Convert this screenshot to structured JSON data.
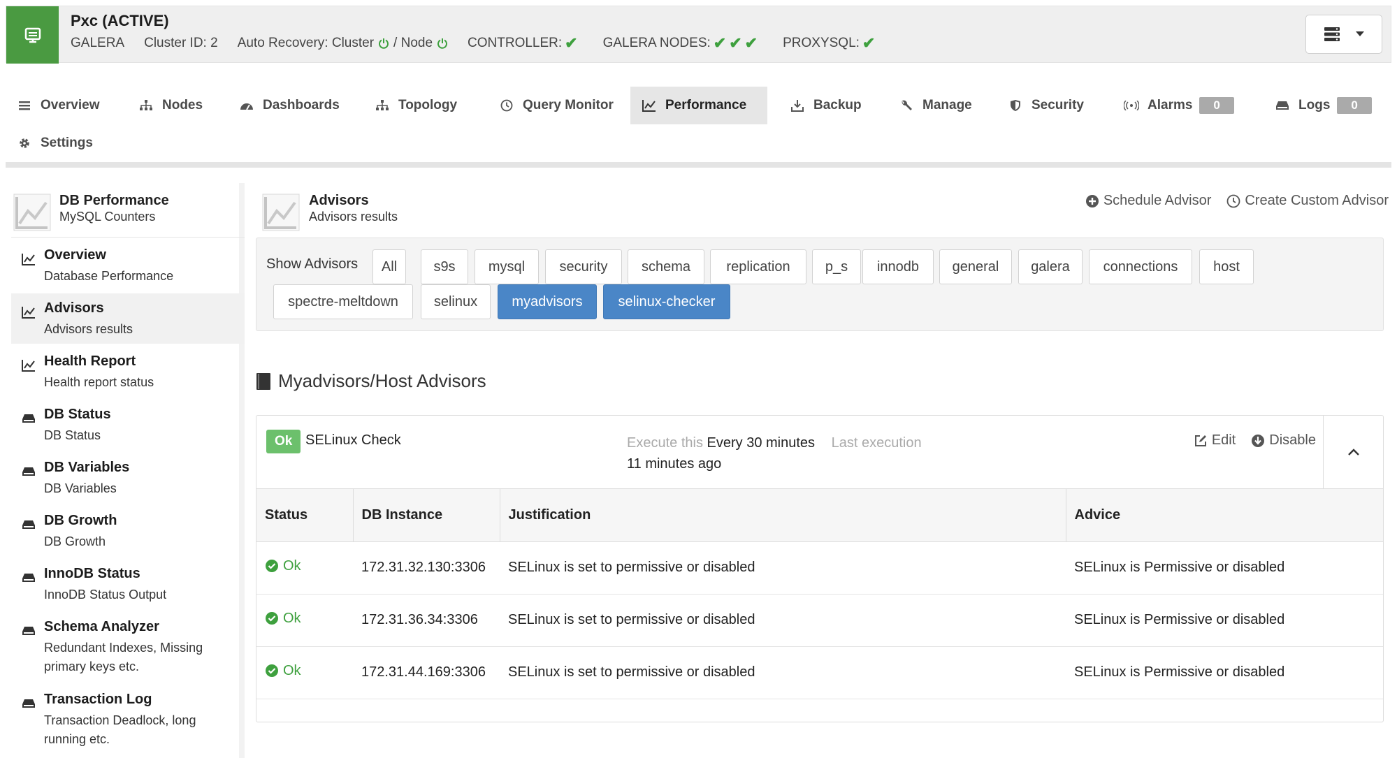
{
  "cluster": {
    "title": "Pxc (ACTIVE)",
    "type": "GALERA",
    "cluster_id": "Cluster ID: 2",
    "auto_recovery": "Auto Recovery: Cluster",
    "node_label": "/ Node",
    "controller": "CONTROLLER:",
    "galera_nodes": "GALERA NODES:",
    "proxysql": "PROXYSQL:",
    "accent": "#4a9a41",
    "ok_color": "#3ea03e"
  },
  "nav": {
    "items": [
      {
        "label": "Overview",
        "icon": "list-icon"
      },
      {
        "label": "Nodes",
        "icon": "sitemap-icon"
      },
      {
        "label": "Dashboards",
        "icon": "dashboard-icon"
      },
      {
        "label": "Topology",
        "icon": "topology-icon"
      },
      {
        "label": "Query Monitor",
        "icon": "clock-icon"
      },
      {
        "label": "Performance",
        "icon": "line-chart-icon"
      },
      {
        "label": "Backup",
        "icon": "download-icon"
      },
      {
        "label": "Manage",
        "icon": "wrench-icon"
      },
      {
        "label": "Security",
        "icon": "shield-icon"
      },
      {
        "label": "Alarms",
        "icon": "broadcast-icon",
        "badge": "0"
      },
      {
        "label": "Logs",
        "icon": "database-icon",
        "badge": "0"
      },
      {
        "label": "Settings",
        "icon": "gear-icon"
      }
    ],
    "active": "Performance"
  },
  "sidebar": {
    "title": "DB Performance",
    "subtitle": "MySQL Counters",
    "items": [
      {
        "title": "Overview",
        "sub": "Database Performance",
        "icon": "line-chart-icon"
      },
      {
        "title": "Advisors",
        "sub": "Advisors results",
        "icon": "line-chart-icon"
      },
      {
        "title": "Health Report",
        "sub": "Health report status",
        "icon": "line-chart-icon"
      },
      {
        "title": "DB Status",
        "sub": "DB Status",
        "icon": "drive-icon"
      },
      {
        "title": "DB Variables",
        "sub": "DB Variables",
        "icon": "drive-icon"
      },
      {
        "title": "DB Growth",
        "sub": "DB Growth",
        "icon": "drive-icon"
      },
      {
        "title": "InnoDB Status",
        "sub": "InnoDB Status Output",
        "icon": "drive-icon"
      },
      {
        "title": "Schema Analyzer",
        "sub": "Redundant Indexes, Missing primary keys etc.",
        "icon": "drive-icon"
      },
      {
        "title": "Transaction Log",
        "sub": "Transaction Deadlock, long running etc.",
        "icon": "drive-icon"
      }
    ]
  },
  "content": {
    "title": "Advisors",
    "subtitle": "Advisors results",
    "schedule_label": "Schedule Advisor",
    "create_label": "Create Custom Advisor"
  },
  "filters": {
    "label": "Show Advisors",
    "buttons": [
      "All",
      "s9s",
      "mysql",
      "security",
      "schema",
      "replication",
      "p_s",
      "innodb",
      "general",
      "galera",
      "connections",
      "host",
      "spectre-meltdown",
      "selinux",
      "myadvisors",
      "selinux-checker"
    ],
    "selected": [
      "myadvisors",
      "selinux-checker"
    ],
    "selected_color": "#4a86c7"
  },
  "section": {
    "title": "Myadvisors/Host Advisors"
  },
  "advisor": {
    "status_badge": "Ok",
    "name": "SELinux Check",
    "execute_label": "Execute this",
    "execute_value": "Every 30 minutes",
    "last_label": "Last execution",
    "last_value": "11 minutes ago",
    "edit_label": "Edit",
    "disable_label": "Disable",
    "columns": [
      "Status",
      "DB Instance",
      "Justification",
      "Advice"
    ],
    "rows": [
      {
        "status": "Ok",
        "instance": "172.31.32.130:3306",
        "justification": "SELinux is set to permissive or disabled",
        "advice": "SELinux is Permissive or disabled"
      },
      {
        "status": "Ok",
        "instance": "172.31.36.34:3306",
        "justification": "SELinux is set to permissive or disabled",
        "advice": "SELinux is Permissive or disabled"
      },
      {
        "status": "Ok",
        "instance": "172.31.44.169:3306",
        "justification": "SELinux is set to permissive or disabled",
        "advice": "SELinux is Permissive or disabled"
      }
    ]
  }
}
